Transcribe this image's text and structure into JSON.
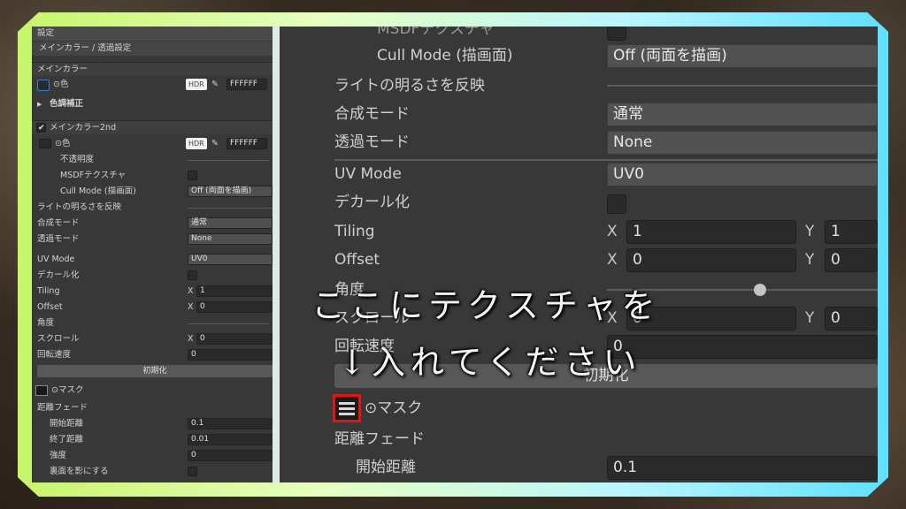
{
  "left_panel": {
    "header": "設定",
    "breadcrumb": "メインカラー / 透過設定",
    "main_color_title": "メインカラー",
    "color_label": "⊙色",
    "hdr": "HDR",
    "hex": "FFFFFF",
    "tone_correction": "色調補正",
    "main_color2_title": "メインカラー2nd",
    "color2_label": "⊙色",
    "hex2": "FFFFFF",
    "opacity": "不透明度",
    "msdf": "MSDFテクスチャ",
    "cull_mode_label": "Cull Mode (描画面)",
    "cull_mode_value": "Off (両面を描画)",
    "light_reflect": "ライトの明るさを反映",
    "blend_mode_label": "合成モード",
    "blend_mode_value": "通常",
    "alpha_mode_label": "透過モード",
    "alpha_mode_value": "None",
    "uv_mode_label": "UV Mode",
    "uv_mode_value": "UV0",
    "decal": "デカール化",
    "tiling": "Tiling",
    "tiling_x": "1",
    "offset": "Offset",
    "offset_x": "0",
    "angle": "角度",
    "scroll": "スクロール",
    "scroll_x": "0",
    "rotate_speed": "回転速度",
    "rotate_speed_value": "0",
    "reset": "初期化",
    "mask": "⊙マスク",
    "distance_fade": "距離フェード",
    "fade_start": "開始距離",
    "fade_start_value": "0.1",
    "fade_end": "終了距離",
    "fade_end_value": "0.01",
    "strength": "強度",
    "strength_value": "0",
    "backface_shadow": "裏面を影にする"
  },
  "right_panel": {
    "msdf_partial": "MSDFテクスチャ",
    "cull_mode_label": "Cull Mode (描画面)",
    "cull_mode_value": "Off (両面を描画)",
    "light_reflect": "ライトの明るさを反映",
    "blend_mode_label": "合成モード",
    "blend_mode_value": "通常",
    "alpha_mode_label": "透過モード",
    "alpha_mode_value": "None",
    "uv_mode_label": "UV Mode",
    "uv_mode_value": "UV0",
    "decal": "デカール化",
    "tiling": "Tiling",
    "tiling_x": "1",
    "tiling_y": "1",
    "offset": "Offset",
    "offset_x": "0",
    "offset_y": "0",
    "angle": "角度",
    "scroll": "スクロール",
    "scroll_x": "0",
    "scroll_y": "0",
    "rotate_speed": "回転速度",
    "rotate_speed_value": "0",
    "reset": "初期化",
    "mask": "⊙マスク",
    "distance_fade": "距離フェード",
    "fade_start": "開始距離",
    "fade_start_value": "0.1",
    "axis_x": "X",
    "axis_y": "Y"
  },
  "overlay": {
    "line1": "ここにテクスチャを",
    "line2": "↓入れてください"
  },
  "colors": {
    "frame_left": "#c8f56a",
    "frame_right": "#5fe0ff",
    "mask_highlight": "#e21414",
    "panel_bg": "#383838"
  }
}
